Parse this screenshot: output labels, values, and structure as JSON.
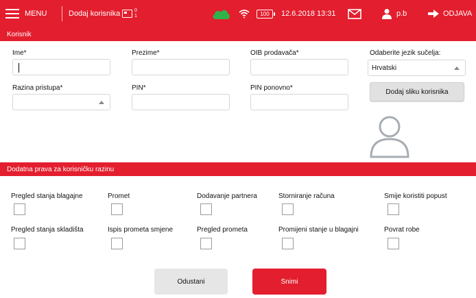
{
  "topbar": {
    "menu_label": "MENU",
    "breadcrumb": "Dodaj korisnika",
    "register_counts": [
      "0",
      "1"
    ],
    "battery": "100",
    "datetime": "12.6.2018 13:31",
    "user": "p.b",
    "logout_label": "ODJAVA",
    "icons": [
      "hamburger-menu-icon",
      "cash-register-icon",
      "cloud-icon",
      "wifi-icon",
      "battery-icon",
      "mail-icon",
      "user-icon",
      "logout-arrow-icon"
    ],
    "colors": {
      "bar": "#e31e2e",
      "cloud": "#2eb34a"
    }
  },
  "section_user": {
    "title": "Korisnik"
  },
  "form": {
    "ime": {
      "label": "Ime*",
      "value": ""
    },
    "prezime": {
      "label": "Prezime*",
      "value": ""
    },
    "oib": {
      "label": "OIB prodavača*",
      "value": ""
    },
    "language": {
      "label": "Odaberite jezik sučelja:",
      "selected": "Hrvatski"
    },
    "level": {
      "label": "Razina pristupa*",
      "selected": ""
    },
    "pin": {
      "label": "PIN*",
      "value": ""
    },
    "pin_repeat": {
      "label": "PIN ponovno*",
      "value": ""
    },
    "photo_button": "Dodaj sliku korisnika"
  },
  "section_rights": {
    "title": "Dodatna prava za korisničku razinu"
  },
  "rights": [
    {
      "label": "Pregled stanja blagajne",
      "checked": false
    },
    {
      "label": "Promet",
      "checked": false
    },
    {
      "label": "Dodavanje partnera",
      "checked": false
    },
    {
      "label": "Storniranje računa",
      "checked": false
    },
    {
      "label": "Smije koristiti popust",
      "checked": false
    },
    {
      "label": "Pregled stanja skladišta",
      "checked": false
    },
    {
      "label": "Ispis prometa smjene",
      "checked": false
    },
    {
      "label": "Pregled prometa",
      "checked": false
    },
    {
      "label": "Promijeni stanje u blagajni",
      "checked": false
    },
    {
      "label": "Povrat robe",
      "checked": false
    }
  ],
  "actions": {
    "cancel": "Odustani",
    "save": "Snimi"
  }
}
